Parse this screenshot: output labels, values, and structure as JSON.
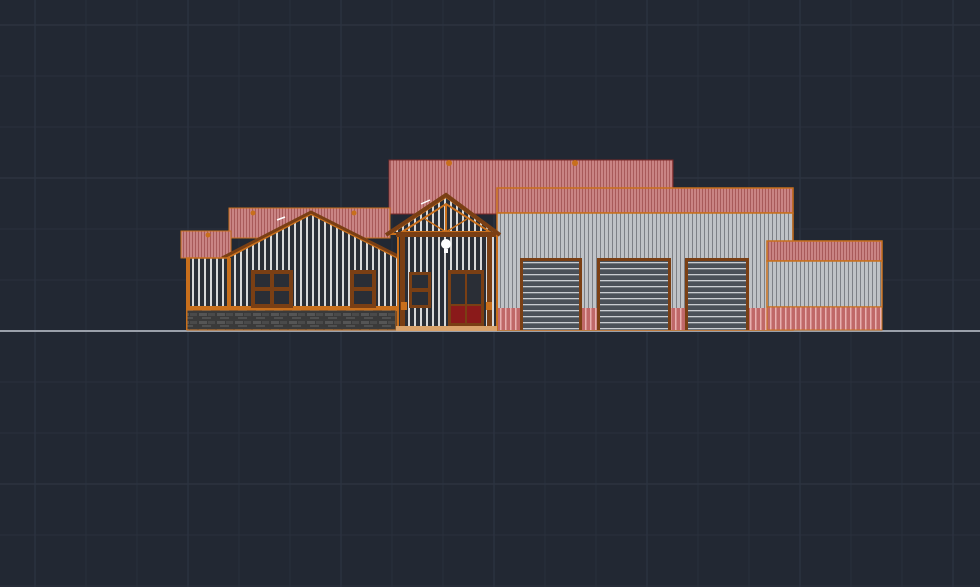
{
  "canvas": {
    "background": "#222833",
    "grid_color": "#2c3340",
    "ground_line_color": "#9aa0aa"
  },
  "drawing": {
    "type": "building-front-elevation",
    "colors": {
      "roof": "#c98484",
      "roof_stripe": "#a85a5a",
      "trim": "#c86f1c",
      "siding_dark": "#2a2e36",
      "siding_light": "#d8d8d8",
      "metal_siding": "#bfc2c6",
      "stone": "#3a3a3a",
      "window_frame": "#7a3f14",
      "door": "#8a1a1a",
      "garage_door": "#4a5058",
      "wainscot": "#b45a5a"
    },
    "components": [
      "main-roof",
      "house-roof-left",
      "house-gable",
      "entry-gable",
      "garage-roof",
      "side-shed-roof",
      "board-and-batten-siding",
      "stone-wainscot",
      "window-left",
      "window-right",
      "entry-window",
      "entry-double-door",
      "garage-door-1",
      "garage-door-2",
      "garage-door-3",
      "side-shed-metal-siding"
    ]
  }
}
